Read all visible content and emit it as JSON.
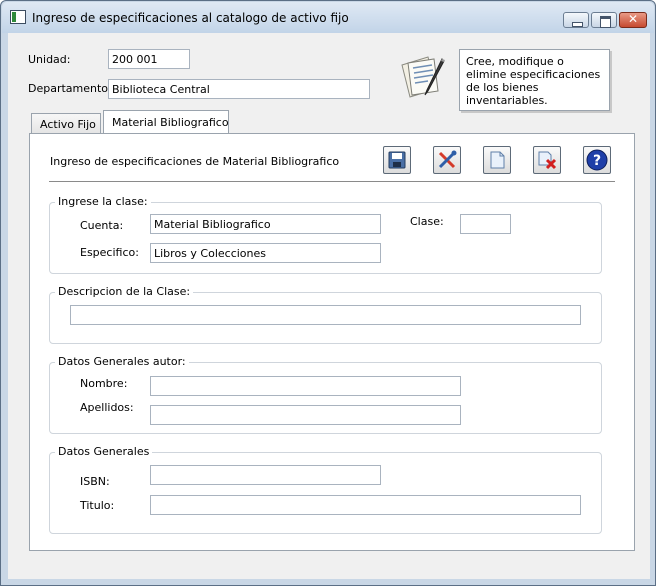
{
  "window": {
    "title": "Ingreso de especificaciones al catalogo de activo fijo"
  },
  "header": {
    "unidad_label": "Unidad:",
    "unidad_value": "200 001",
    "departamento_label": "Departamento:",
    "departamento_value": "Biblioteca Central",
    "info_text": "Cree, modifique o elimine especificaciones de los bienes inventariables."
  },
  "tabs": [
    {
      "label": "Activo Fijo",
      "selected": false
    },
    {
      "label": "Material Bibliografico",
      "selected": true
    }
  ],
  "panel": {
    "title": "Ingreso de especificaciones de Material Bibliografico",
    "toolbar": [
      {
        "name": "save",
        "icon": "floppy-disk-icon"
      },
      {
        "name": "edit",
        "icon": "tools-icon"
      },
      {
        "name": "new",
        "icon": "new-document-icon"
      },
      {
        "name": "delete",
        "icon": "delete-document-icon"
      },
      {
        "name": "help",
        "icon": "help-icon"
      }
    ],
    "clase_group": {
      "title": "Ingrese la clase:",
      "cuenta_label": "Cuenta:",
      "cuenta_value": "Material Bibliografico",
      "especifico_label": "Especifico:",
      "especifico_value": "Libros y Colecciones",
      "clase_label": "Clase:",
      "clase_value": ""
    },
    "descripcion_group": {
      "title": "Descripcion de la Clase:",
      "value": ""
    },
    "autor_group": {
      "title": "Datos Generales autor:",
      "nombre_label": "Nombre:",
      "nombre_value": "",
      "apellidos_label": "Apellidos:",
      "apellidos_value": ""
    },
    "generales_group": {
      "title": "Datos Generales",
      "isbn_label": "ISBN:",
      "isbn_value": "",
      "titulo_label": "Titulo:",
      "titulo_value": ""
    }
  },
  "colors": {
    "titlebar": "#c9d7e6",
    "close_button": "#c64a30",
    "help_button": "#1f3fa8",
    "delete_mark": "#d21f1f"
  }
}
